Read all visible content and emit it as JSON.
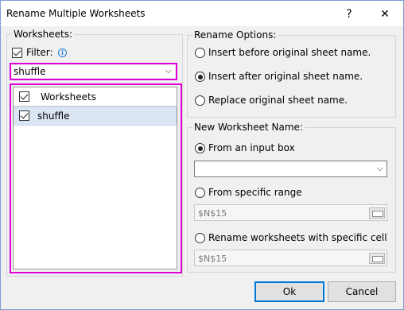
{
  "window": {
    "title": "Rename Multiple Worksheets",
    "help_label": "?",
    "close_label": "✕"
  },
  "worksheets_panel": {
    "group_label": "Worksheets:",
    "filter_label": "Filter:",
    "filter_checked": true,
    "info_icon": "info-icon",
    "filter_value": "shuffle",
    "list_header": "Worksheets",
    "list_header_checked": true,
    "items": [
      {
        "label": "shuffle",
        "checked": true,
        "selected": true
      }
    ],
    "highlight_color": "#e000d8"
  },
  "rename_options": {
    "group_label": "Rename Options:",
    "options": [
      {
        "label": "Insert before original sheet name.",
        "checked": false
      },
      {
        "label": "Insert after original sheet name.",
        "checked": true
      },
      {
        "label": "Replace original sheet name.",
        "checked": false
      }
    ]
  },
  "new_name": {
    "group_label": "New Worksheet Name:",
    "from_input_label": "From an input box",
    "from_input_checked": true,
    "input_value": "",
    "from_range_label": "From specific range",
    "from_range_value": "$N$15",
    "from_cell_label": "Rename worksheets with specific cell",
    "from_cell_value": "$N$15"
  },
  "buttons": {
    "ok_label": "Ok",
    "cancel_label": "Cancel"
  }
}
